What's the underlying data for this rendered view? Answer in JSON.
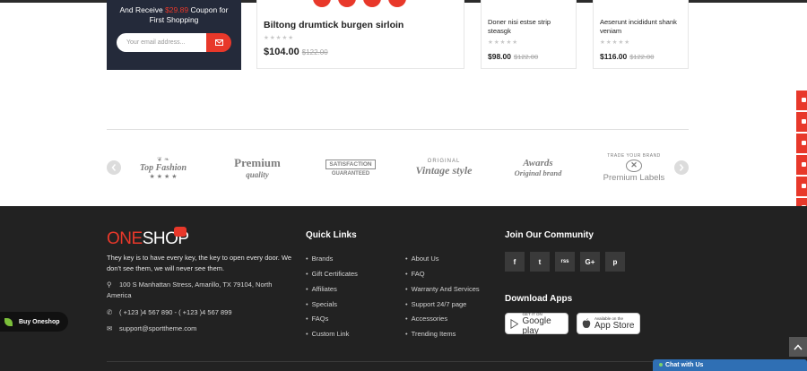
{
  "newsletter": {
    "text_prefix": "And Receive",
    "amount": "$29.89",
    "text_suffix": "Coupon for First Shopping",
    "email_placeholder": "Your email address...",
    "submit_icon": "envelope-icon"
  },
  "products": [
    {
      "name": "Biltong drumtick burgen sirloin",
      "stars": "★★★★★",
      "price": "$104.00",
      "old_price": "$122.00"
    },
    {
      "name": "Doner nisi estse strip steasgk",
      "stars": "★★★★★",
      "price": "$98.00",
      "old_price": "$122.00"
    },
    {
      "name": "Aeserunt incididunt shank veniam",
      "stars": "★★★★★",
      "price": "$116.00",
      "old_price": "$122.00"
    }
  ],
  "brands": {
    "prev_icon": "chevron-left-icon",
    "next_icon": "chevron-right-icon",
    "logos": [
      {
        "text": "Top Fashion",
        "sub": "★ ★ ★ ★"
      },
      {
        "text": "Premium",
        "sub": "quality"
      },
      {
        "text": "SATISFACTION",
        "sub": "GUARANTEED"
      },
      {
        "text": "Vintage style",
        "sub": "ORIGINAL"
      },
      {
        "text": "Awards",
        "sub": "Original brand"
      },
      {
        "text": "Premium Labels",
        "sub": "TRADE YOUR BRAND"
      }
    ]
  },
  "footer": {
    "logo_one": "ONE",
    "logo_shop": "SHOP",
    "about": "They key is to have every key, the key to open every door. We don't see them, we will never see them.",
    "address": "100 S Manhattan Stress, Amarillo, TX 79104, North America",
    "phone": "( +123 )4 567 890 - ( +123 )4 567 899",
    "email": "support@sporttheme.com",
    "quick_links_title": "Quick Links",
    "links_col1": [
      "Brands",
      "Gift Certificates",
      "Affiliates",
      "Specials",
      "FAQs",
      "Custom Link"
    ],
    "links_col2": [
      "About Us",
      "FAQ",
      "Warranty And Services",
      "Support 24/7 page",
      "Accessories",
      "Trending Items"
    ],
    "community_title": "Join Our Community",
    "social": [
      "f",
      "t",
      "rss",
      "G+",
      "p"
    ],
    "apps_title": "Download Apps",
    "google_small": "GET IT ON",
    "google_big": "Google play",
    "apple_small": "Available on the",
    "apple_big": "App Store"
  },
  "widgets": {
    "buy_label": "Buy Oneshop",
    "chat_label": "Chat with Us"
  },
  "colors": {
    "accent": "#e8382a",
    "footer_bg": "#222222",
    "newsletter_bg": "#242a3a",
    "chat": "#2f6fb4"
  }
}
